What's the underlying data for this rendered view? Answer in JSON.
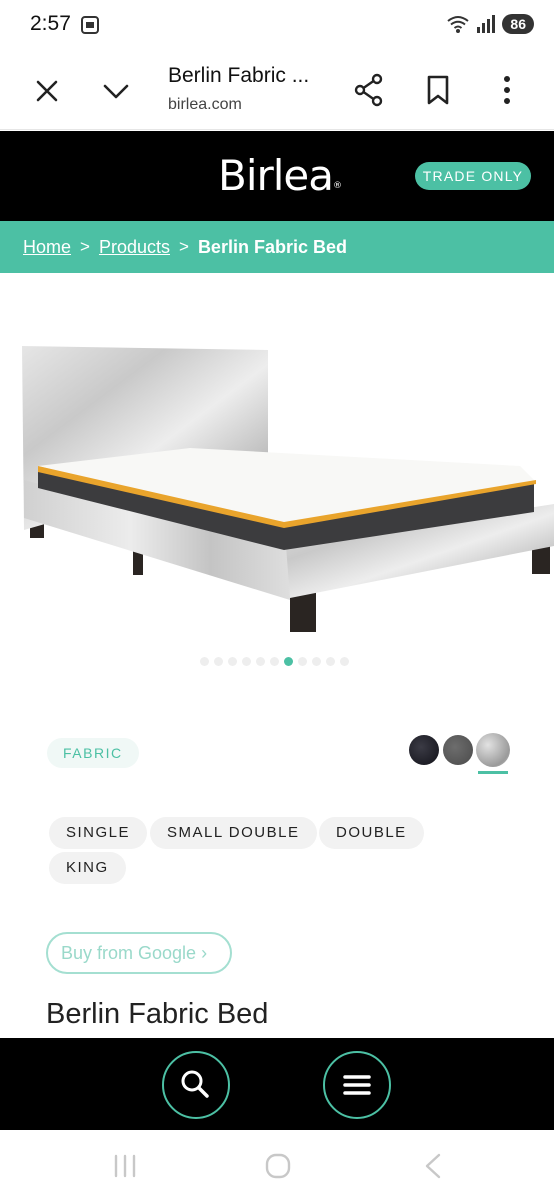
{
  "status_bar": {
    "time": "2:57",
    "battery": "86"
  },
  "browser": {
    "title": "Berlin Fabric ...",
    "url": "birlea.com"
  },
  "site": {
    "logo": "Birlea",
    "logo_mark": "®",
    "trade_label": "TRADE ONLY",
    "accent_color": "#4cc0a4"
  },
  "breadcrumb": {
    "items": [
      "Home",
      "Products"
    ],
    "current": "Berlin Fabric Bed",
    "separator": ">"
  },
  "gallery": {
    "image_alt": "Silver crushed velvet fabric bed with mattress",
    "dot_count": 11,
    "active_index": 6
  },
  "product": {
    "material_tag": "FABRIC",
    "swatches": [
      "black",
      "grey",
      "silver"
    ],
    "selected_swatch_index": 2,
    "sizes": [
      "SINGLE",
      "SMALL DOUBLE",
      "DOUBLE",
      "KING"
    ],
    "buy_label": "Buy from Google",
    "buy_chevron": "›",
    "title": "Berlin Fabric Bed"
  },
  "bottom_bar": {
    "icons": [
      "search-icon",
      "menu-icon"
    ]
  }
}
